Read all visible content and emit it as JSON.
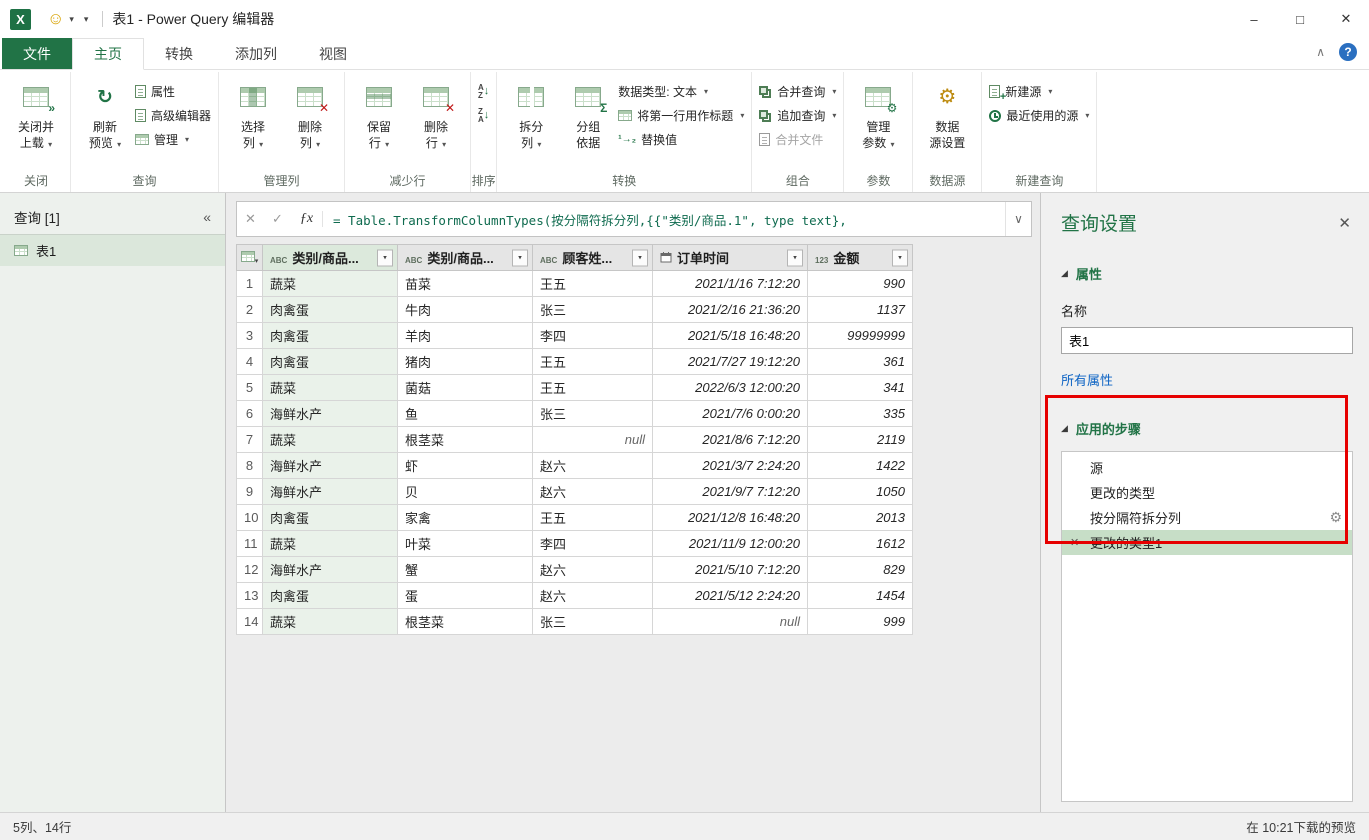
{
  "icons": {
    "excel": "X",
    "smiley": "☺",
    "dropdown": "▾",
    "minimize": "–",
    "maximize": "□",
    "close": "✕",
    "collapse_ribbon": "∧",
    "help": "?",
    "collapse_pane": "«",
    "cancel": "✕",
    "confirm": "✓",
    "fx": "ƒx",
    "expand": "∨",
    "gear": "⚙",
    "delete_step": "✕",
    "section_triangle": "◢"
  },
  "titlebar": {
    "title": "表1 - Power Query 编辑器"
  },
  "tabs": {
    "file": "文件",
    "items": [
      "主页",
      "转换",
      "添加列",
      "视图"
    ]
  },
  "ribbon": {
    "groups": [
      {
        "label": "关闭",
        "items": [
          {
            "kind": "big",
            "name": "close-and-load",
            "l1": "关闭并",
            "l2": "上载",
            "dd": true,
            "icon": "close-load-icon"
          }
        ]
      },
      {
        "label": "查询",
        "items": [
          {
            "kind": "big",
            "name": "refresh-preview",
            "l1": "刷新",
            "l2": "预览",
            "dd": true,
            "icon": "refresh-icon"
          },
          {
            "kind": "small",
            "name": "properties",
            "label": "属性",
            "icon": "properties-icon"
          },
          {
            "kind": "small",
            "name": "advanced-editor",
            "label": "高级编辑器",
            "icon": "advanced-editor-icon"
          },
          {
            "kind": "small",
            "name": "manage",
            "label": "管理",
            "dd": true,
            "icon": "manage-icon"
          }
        ]
      },
      {
        "label": "管理列",
        "items": [
          {
            "kind": "big",
            "name": "choose-columns",
            "l1": "选择",
            "l2": "列",
            "dd": true,
            "icon": "choose-columns-icon"
          },
          {
            "kind": "big",
            "name": "remove-columns",
            "l1": "删除",
            "l2": "列",
            "dd": true,
            "icon": "remove-columns-icon"
          }
        ]
      },
      {
        "label": "减少行",
        "items": [
          {
            "kind": "big",
            "name": "keep-rows",
            "l1": "保留",
            "l2": "行",
            "dd": true,
            "icon": "keep-rows-icon"
          },
          {
            "kind": "big",
            "name": "remove-rows",
            "l1": "删除",
            "l2": "行",
            "dd": true,
            "icon": "remove-rows-icon"
          }
        ]
      },
      {
        "label": "排序",
        "items": [
          {
            "kind": "small",
            "name": "sort-ascending",
            "label": "",
            "icon": "sort-asc-icon"
          },
          {
            "kind": "small",
            "name": "sort-descending",
            "label": "",
            "icon": "sort-desc-icon"
          }
        ]
      },
      {
        "label": "转换",
        "items": [
          {
            "kind": "big",
            "name": "split-column",
            "l1": "拆分",
            "l2": "列",
            "dd": true,
            "icon": "split-column-icon"
          },
          {
            "kind": "big",
            "name": "group-by",
            "l1": "分组",
            "l2": "依据",
            "icon": "group-by-icon"
          },
          {
            "kind": "small",
            "name": "data-type",
            "label": "数据类型: 文本",
            "dd": true
          },
          {
            "kind": "small",
            "name": "use-first-row-as-headers",
            "label": "将第一行用作标题",
            "dd": true,
            "icon": "first-row-headers-icon"
          },
          {
            "kind": "small",
            "name": "replace-values",
            "label": "替换值",
            "icon": "replace-values-icon"
          }
        ]
      },
      {
        "label": "组合",
        "items": [
          {
            "kind": "small",
            "name": "merge-queries",
            "label": "合并查询",
            "dd": true,
            "icon": "merge-queries-icon"
          },
          {
            "kind": "small",
            "name": "append-queries",
            "label": "追加查询",
            "dd": true,
            "icon": "append-queries-icon"
          },
          {
            "kind": "small",
            "name": "combine-files",
            "label": "合并文件",
            "icon": "combine-files-icon",
            "disabled": true
          }
        ]
      },
      {
        "label": "参数",
        "items": [
          {
            "kind": "big",
            "name": "manage-parameters",
            "l1": "管理",
            "l2": "参数",
            "dd": true,
            "icon": "manage-parameters-icon"
          }
        ]
      },
      {
        "label": "数据源",
        "items": [
          {
            "kind": "big",
            "name": "data-source-settings",
            "l1": "数据",
            "l2": "源设置",
            "icon": "data-source-settings-icon"
          }
        ]
      },
      {
        "label": "新建查询",
        "items": [
          {
            "kind": "small",
            "name": "new-source",
            "label": "新建源",
            "dd": true,
            "icon": "new-source-icon"
          },
          {
            "kind": "small",
            "name": "recent-sources",
            "label": "最近使用的源",
            "dd": true,
            "icon": "recent-sources-icon"
          }
        ]
      }
    ]
  },
  "formula_bar": {
    "formula": "= Table.TransformColumnTypes(按分隔符拆分列,{{\"类别/商品.1\", type text},"
  },
  "queries_pane": {
    "header": "查询 [1]",
    "items": [
      {
        "name": "表1",
        "selected": true
      }
    ]
  },
  "table": {
    "columns": [
      {
        "name": "类别/商品...",
        "type_icon": "ABC",
        "selected": true
      },
      {
        "name": "类别/商品...",
        "type_icon": "ABC"
      },
      {
        "name": "顾客姓...",
        "type_icon": "ABC"
      },
      {
        "name": "订单时间",
        "type_icon": "date"
      },
      {
        "name": "金额",
        "type_icon": "123"
      }
    ],
    "rows": [
      [
        "蔬菜",
        "苗菜",
        "王五",
        "2021/1/16 7:12:20",
        "990"
      ],
      [
        "肉禽蛋",
        "牛肉",
        "张三",
        "2021/2/16 21:36:20",
        "1137"
      ],
      [
        "肉禽蛋",
        "羊肉",
        "李四",
        "2021/5/18 16:48:20",
        "99999999"
      ],
      [
        "肉禽蛋",
        "猪肉",
        "王五",
        "2021/7/27 19:12:20",
        "361"
      ],
      [
        "蔬菜",
        "菌菇",
        "王五",
        "2022/6/3 12:00:20",
        "341"
      ],
      [
        "海鲜水产",
        "鱼",
        "张三",
        "2021/7/6 0:00:20",
        "335"
      ],
      [
        "蔬菜",
        "根茎菜",
        "null",
        "2021/8/6 7:12:20",
        "2119"
      ],
      [
        "海鲜水产",
        "虾",
        "赵六",
        "2021/3/7 2:24:20",
        "1422"
      ],
      [
        "海鲜水产",
        "贝",
        "赵六",
        "2021/9/7 7:12:20",
        "1050"
      ],
      [
        "肉禽蛋",
        "家禽",
        "王五",
        "2021/12/8 16:48:20",
        "2013"
      ],
      [
        "蔬菜",
        "叶菜",
        "李四",
        "2021/11/9 12:00:20",
        "1612"
      ],
      [
        "海鲜水产",
        "蟹",
        "赵六",
        "2021/5/10 7:12:20",
        "829"
      ],
      [
        "肉禽蛋",
        "蛋",
        "赵六",
        "2021/5/12 2:24:20",
        "1454"
      ],
      [
        "蔬菜",
        "根茎菜",
        "张三",
        "null",
        "999"
      ]
    ]
  },
  "query_settings": {
    "title": "查询设置",
    "properties_header": "属性",
    "name_label": "名称",
    "name_value": "表1",
    "all_properties": "所有属性",
    "steps_header": "应用的步骤",
    "steps": [
      {
        "label": "源"
      },
      {
        "label": "更改的类型"
      },
      {
        "label": "按分隔符拆分列",
        "gear": true
      },
      {
        "label": "更改的类型1",
        "selected": true,
        "deletable": true
      }
    ]
  },
  "status_bar": {
    "left": "5列、14行",
    "right": "在 10:21下载的预览"
  }
}
